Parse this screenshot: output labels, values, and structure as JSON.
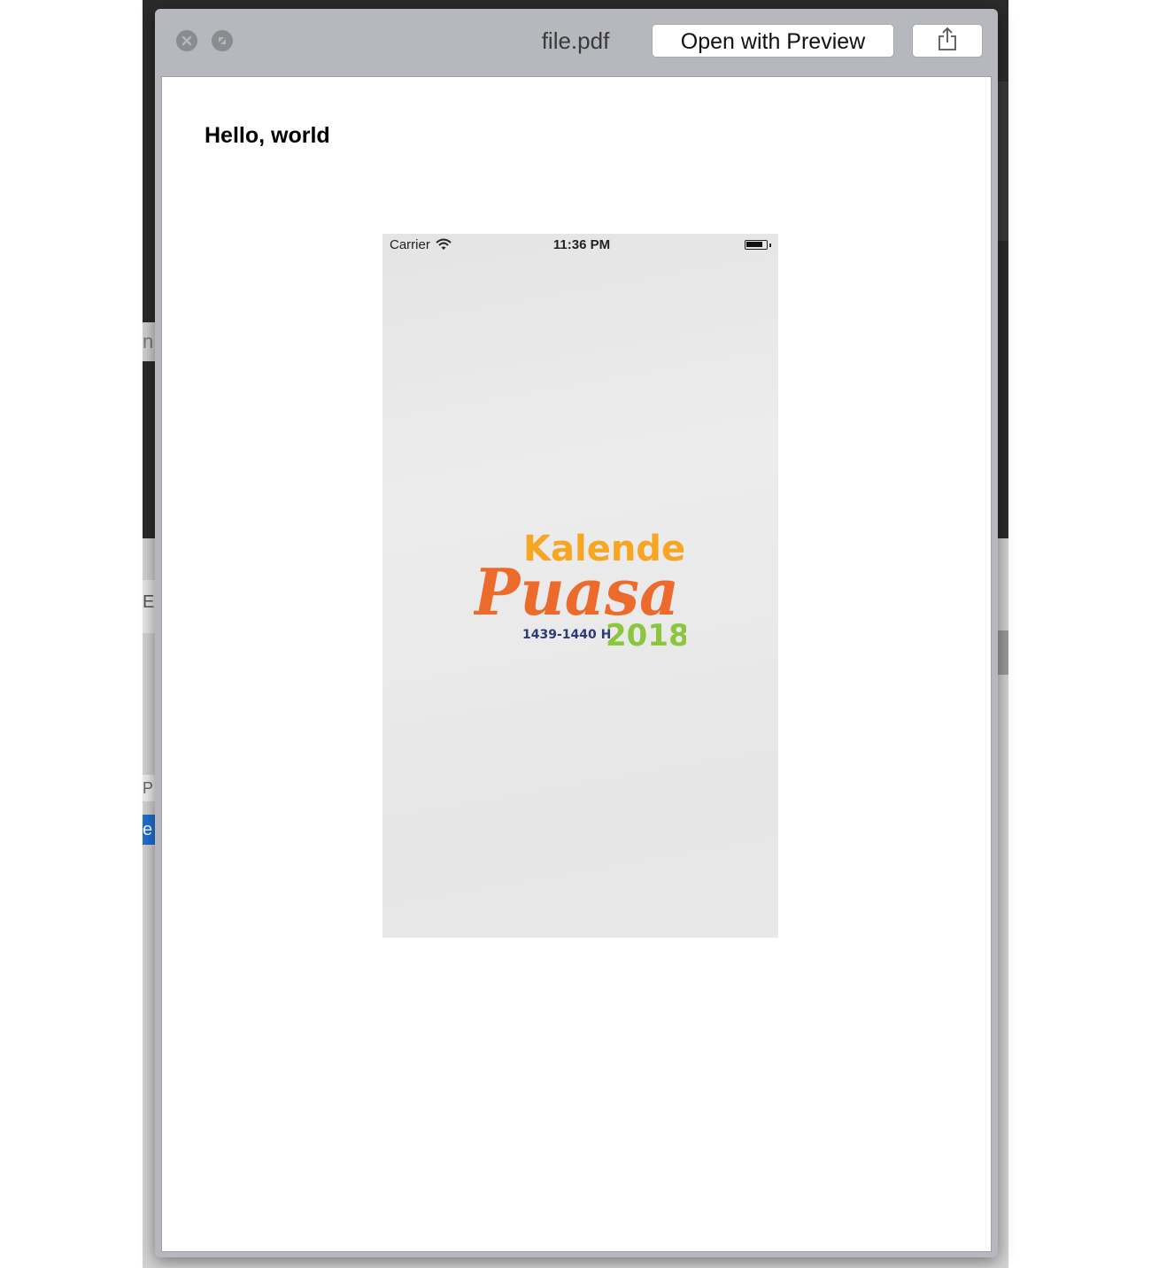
{
  "window": {
    "title": "file.pdf",
    "open_button_label": "Open with Preview",
    "icons": [
      "close-icon",
      "fullscreen-icon",
      "share-icon"
    ]
  },
  "document": {
    "heading": "Hello, world"
  },
  "phone": {
    "carrier": "Carrier",
    "time": "11:36 PM",
    "battery_level": 0.85,
    "logo": {
      "line1": "Kalender",
      "line2": "Puasa",
      "hijri": "1439-1440 H",
      "year": "2018",
      "colors": {
        "kalender": "#f6a623",
        "puasa": "#ec6a2c",
        "hijri": "#2d3a7a",
        "year": "#8cc63f"
      }
    }
  },
  "background_fragments": [
    "n",
    "E",
    "P",
    "e"
  ]
}
